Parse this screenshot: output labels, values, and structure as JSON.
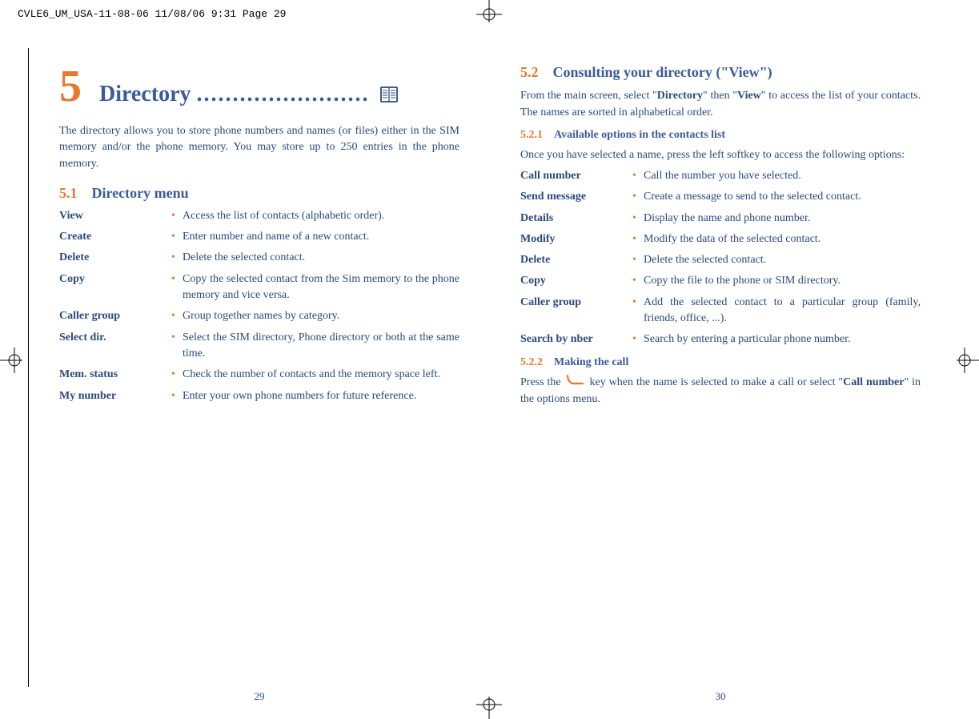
{
  "header": "CVLE6_UM_USA-11-08-06  11/08/06  9:31  Page 29",
  "left": {
    "chapter_num": "5",
    "chapter_title": "Directory",
    "chapter_dots": "........................",
    "intro": "The directory allows you to store phone numbers and names (or files) either in the SIM memory and/or the phone memory. You may store up to 250 entries in the phone memory.",
    "h2_num": "5.1",
    "h2_title": "Directory menu",
    "items": [
      {
        "term": "View",
        "def": "Access the list of contacts (alphabetic order)."
      },
      {
        "term": "Create",
        "def": "Enter number and name of a new contact."
      },
      {
        "term": "Delete",
        "def": "Delete the selected contact."
      },
      {
        "term": "Copy",
        "def": "Copy the selected contact from the Sim memory to the phone memory and vice versa."
      },
      {
        "term": "Caller group",
        "def": "Group together names by category."
      },
      {
        "term": "Select dir.",
        "def": "Select the SIM directory, Phone directory or both at the same time."
      },
      {
        "term": "Mem. status",
        "def": "Check the number of contacts and the memory space left."
      },
      {
        "term": "My number",
        "def": "Enter your own phone numbers for future reference."
      }
    ],
    "pagenum": "29"
  },
  "right": {
    "h2_num": "5.2",
    "h2_title": "Consulting your directory (\"View\")",
    "intro_parts": {
      "p1": "From the main screen, select \"",
      "b1": "Directory",
      "p2": "\" then \"",
      "b2": "View",
      "p3": "\" to access the list of your contacts. The names are sorted in alphabetical order."
    },
    "h3a_num": "5.2.1",
    "h3a_title": "Available options in the contacts list",
    "para_a": "Once you have selected a name, press the left softkey to access the following options:",
    "items": [
      {
        "term": "Call number",
        "def": "Call the number you have selected."
      },
      {
        "term": "Send message",
        "def": "Create a message to send to the selected contact."
      },
      {
        "term": "Details",
        "def": "Display the name and phone number."
      },
      {
        "term": "Modify",
        "def": "Modify the data of the selected contact."
      },
      {
        "term": "Delete",
        "def": "Delete the selected contact."
      },
      {
        "term": "Copy",
        "def": "Copy the file to the phone or SIM directory."
      },
      {
        "term": "Caller group",
        "def": "Add the selected contact to a particular group (family, friends, office, ...)."
      },
      {
        "term": "Search by nber",
        "def": "Search by entering a particular phone number."
      }
    ],
    "h3b_num": "5.2.2",
    "h3b_title": "Making the call",
    "call_parts": {
      "p1": "Press the ",
      "p2": " key when the name is selected to make a call or select \"",
      "b1": "Call number",
      "p3": "\" in the options menu."
    },
    "pagenum": "30"
  }
}
